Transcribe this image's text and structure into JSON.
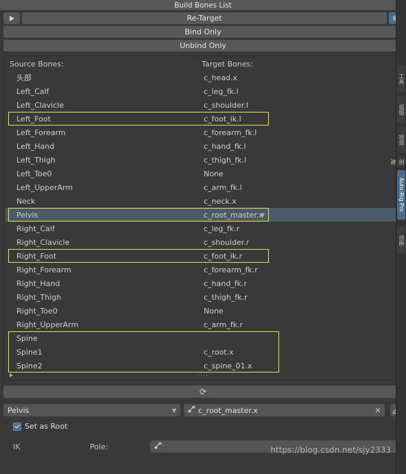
{
  "header": {
    "title": "Build Bones List"
  },
  "buttons": {
    "retarget": "Re-Target",
    "bind_only": "Bind Only",
    "unbind_only": "Unbind Only",
    "play_icon": "play-icon",
    "snowflake_icon": "❄",
    "refresh_icon": "⟳"
  },
  "list": {
    "col_source": "Source Bones:",
    "col_target": "Target Bones:",
    "rows": [
      {
        "source": "头部",
        "target": "c_head.x",
        "state": "normal"
      },
      {
        "source": "Left_Calf",
        "target": "c_leg_fk.l",
        "state": "normal"
      },
      {
        "source": "Left_Clavicle",
        "target": "c_shoulder.l",
        "state": "normal"
      },
      {
        "source": "Left_Foot",
        "target": "c_foot_ik.l",
        "state": "outlined"
      },
      {
        "source": "Left_Forearm",
        "target": "c_forearm_fk.l",
        "state": "normal"
      },
      {
        "source": "Left_Hand",
        "target": "c_hand_fk.l",
        "state": "normal"
      },
      {
        "source": "Left_Thigh",
        "target": "c_thigh_fk.l",
        "state": "normal"
      },
      {
        "source": "Left_Toe0",
        "target": "None",
        "state": "normal"
      },
      {
        "source": "Left_UpperArm",
        "target": "c_arm_fk.l",
        "state": "normal"
      },
      {
        "source": "Neck",
        "target": "c_neck.x",
        "state": "normal"
      },
      {
        "source": "Pelvis",
        "target": "c_root_master.x",
        "state": "selected-outlined"
      },
      {
        "source": "Right_Calf",
        "target": "c_leg_fk.r",
        "state": "normal"
      },
      {
        "source": "Right_Clavicle",
        "target": "c_shoulder.r",
        "state": "normal"
      },
      {
        "source": "Right_Foot",
        "target": "c_foot_ik.r",
        "state": "outlined"
      },
      {
        "source": "Right_Forearm",
        "target": "c_forearm_fk.r",
        "state": "normal"
      },
      {
        "source": "Right_Hand",
        "target": "c_hand_fk.r",
        "state": "normal"
      },
      {
        "source": "Right_Thigh",
        "target": "c_thigh_fk.r",
        "state": "normal"
      },
      {
        "source": "Right_Toe0",
        "target": "None",
        "state": "normal"
      },
      {
        "source": "Right_UpperArm",
        "target": "c_arm_fk.r",
        "state": "normal"
      },
      {
        "source": "Spine",
        "target": "",
        "state": "group-top"
      },
      {
        "source": "Spine1",
        "target": "c_root.x",
        "state": "group-mid"
      },
      {
        "source": "Spine2",
        "target": "c_spine_01.x",
        "state": "group-bottom"
      }
    ]
  },
  "editor": {
    "source_bone": "Pelvis",
    "target_bone": "c_root_master.x",
    "clear_icon": "✕",
    "eyedropper_icon": "eyedropper-icon",
    "bone_icon": "bone-icon",
    "set_as_root_label": "Set as Root",
    "ik_label": "IK",
    "pole_label": "Pole:",
    "pole_value": ""
  },
  "right_tabs": [
    {
      "label": "工具",
      "active": false
    },
    {
      "label": "视图",
      "active": false
    },
    {
      "label": "项目",
      "active": false
    },
    {
      "label": "创建",
      "active": false
    },
    {
      "label": "Auto-Rig Pro",
      "active": true
    },
    {
      "label": "动画",
      "active": false
    }
  ],
  "watermark": "https://blog.csdn.net/sjy2333"
}
